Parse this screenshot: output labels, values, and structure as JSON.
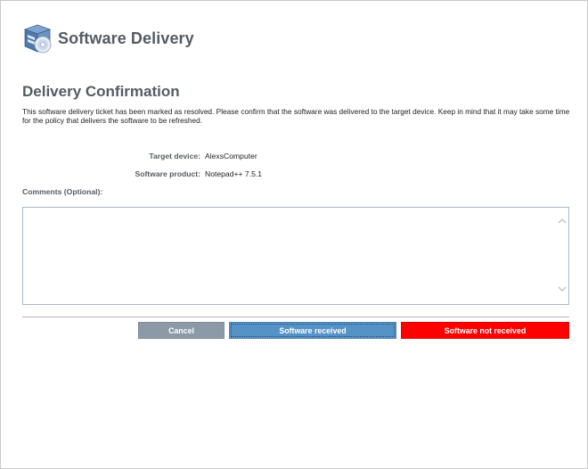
{
  "header": {
    "app_title": "Software Delivery",
    "icon": "software-package-icon"
  },
  "section": {
    "title": "Delivery Confirmation",
    "description": "This software delivery ticket has been marked as resolved. Please confirm that the software was delivered to the target device. Keep in mind that it may take some time for the policy that delivers the software to be refreshed."
  },
  "fields": {
    "target_device_label": "Target device:",
    "target_device_value": "AlexsComputer",
    "software_product_label": "Software product:",
    "software_product_value": "Notepad++ 7.5.1"
  },
  "comments": {
    "label": "Comments (Optional):",
    "value": "",
    "scroll_up_icon": "chevron-up-icon",
    "scroll_down_icon": "chevron-down-icon"
  },
  "buttons": {
    "cancel_label": "Cancel",
    "received_label": "Software received",
    "not_received_label": "Software not received"
  },
  "colors": {
    "title": "#555b63",
    "cancel": "#8c99a7",
    "received": "#5592c6",
    "not_received": "#ff0000",
    "border": "#a9b9cc"
  }
}
